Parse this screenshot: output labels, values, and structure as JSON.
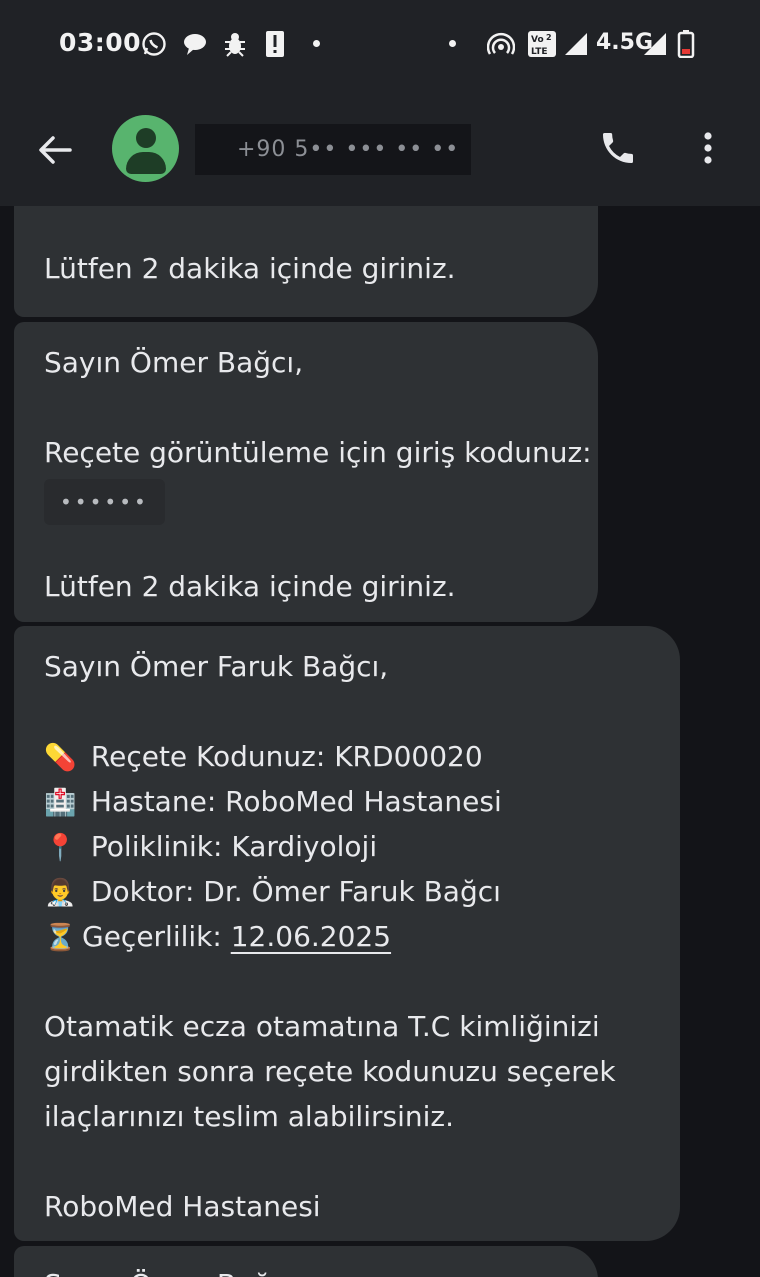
{
  "status_bar": {
    "time": "03:00",
    "network": "4.5G",
    "icons": [
      "whatsapp-icon",
      "chat-icon",
      "bug-icon",
      "alert-icon",
      "dot",
      "dot",
      "hotspot-icon",
      "volte-icon",
      "signal-icon",
      "signal-icon",
      "battery-icon"
    ]
  },
  "header": {
    "phone_number": "+90 5•• ••• •• ••",
    "avatar_color": "#58b46e"
  },
  "messages": [
    {
      "lines": [
        "Lütfen 2 dakika içinde giriniz."
      ]
    },
    {
      "greeting": "Sayın Ömer Bağcı,",
      "text": "Reçete görüntüleme için giriş kodunuz:",
      "masked_code": "••••••",
      "footer": "Lütfen 2 dakika içinde giriniz."
    },
    {
      "greeting": "Sayın Ömer Faruk Bağcı,",
      "items": [
        {
          "emoji": "💊",
          "label": "Reçete Kodunuz: KRD00020"
        },
        {
          "emoji": "🏥",
          "label": "Hastane: RoboMed Hastanesi"
        },
        {
          "emoji": "📍",
          "label": "Poliklinik: Kardiyoloji"
        },
        {
          "emoji": "👨‍⚕️",
          "label": "Doktor: Dr. Ömer Faruk Bağcı"
        },
        {
          "emoji": "⏳",
          "label_prefix": "Geçerlilik: ",
          "date": "12.06.2025"
        }
      ],
      "body_lines": [
        "Otamatik ecza otamatına T.C kimliğinizi",
        "girdikten sonra reçete kodunuzu seçerek",
        "ilaçlarınızı teslim alabilirsiniz."
      ],
      "signature": "RoboMed Hastanesi"
    },
    {
      "partial": "Sayın Ömer Bağcı"
    }
  ]
}
